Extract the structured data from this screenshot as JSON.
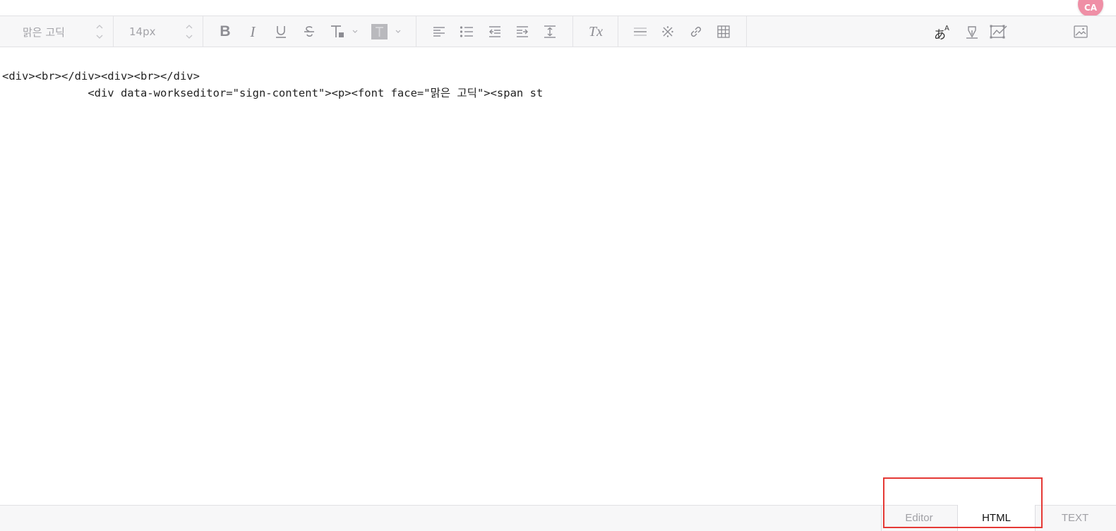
{
  "toolbar": {
    "font_family": "맑은 고딕",
    "font_size": "14px",
    "bold_label": "B",
    "italic_label": "I",
    "clear_format_label": "Tx"
  },
  "editor": {
    "line1": "<div><br></div><div><br></div>",
    "line2": "             <div data-workseditor=\"sign-content\"><p><font face=\"맑은 고딕\"><span st"
  },
  "tabs": {
    "editor": "Editor",
    "html": "HTML",
    "text": "TEXT"
  },
  "avatar": {
    "text": "CA"
  },
  "colors": {
    "highlight": "#e53935",
    "toolbar_bg": "#f7f7f8",
    "icon": "#8d8d93"
  }
}
